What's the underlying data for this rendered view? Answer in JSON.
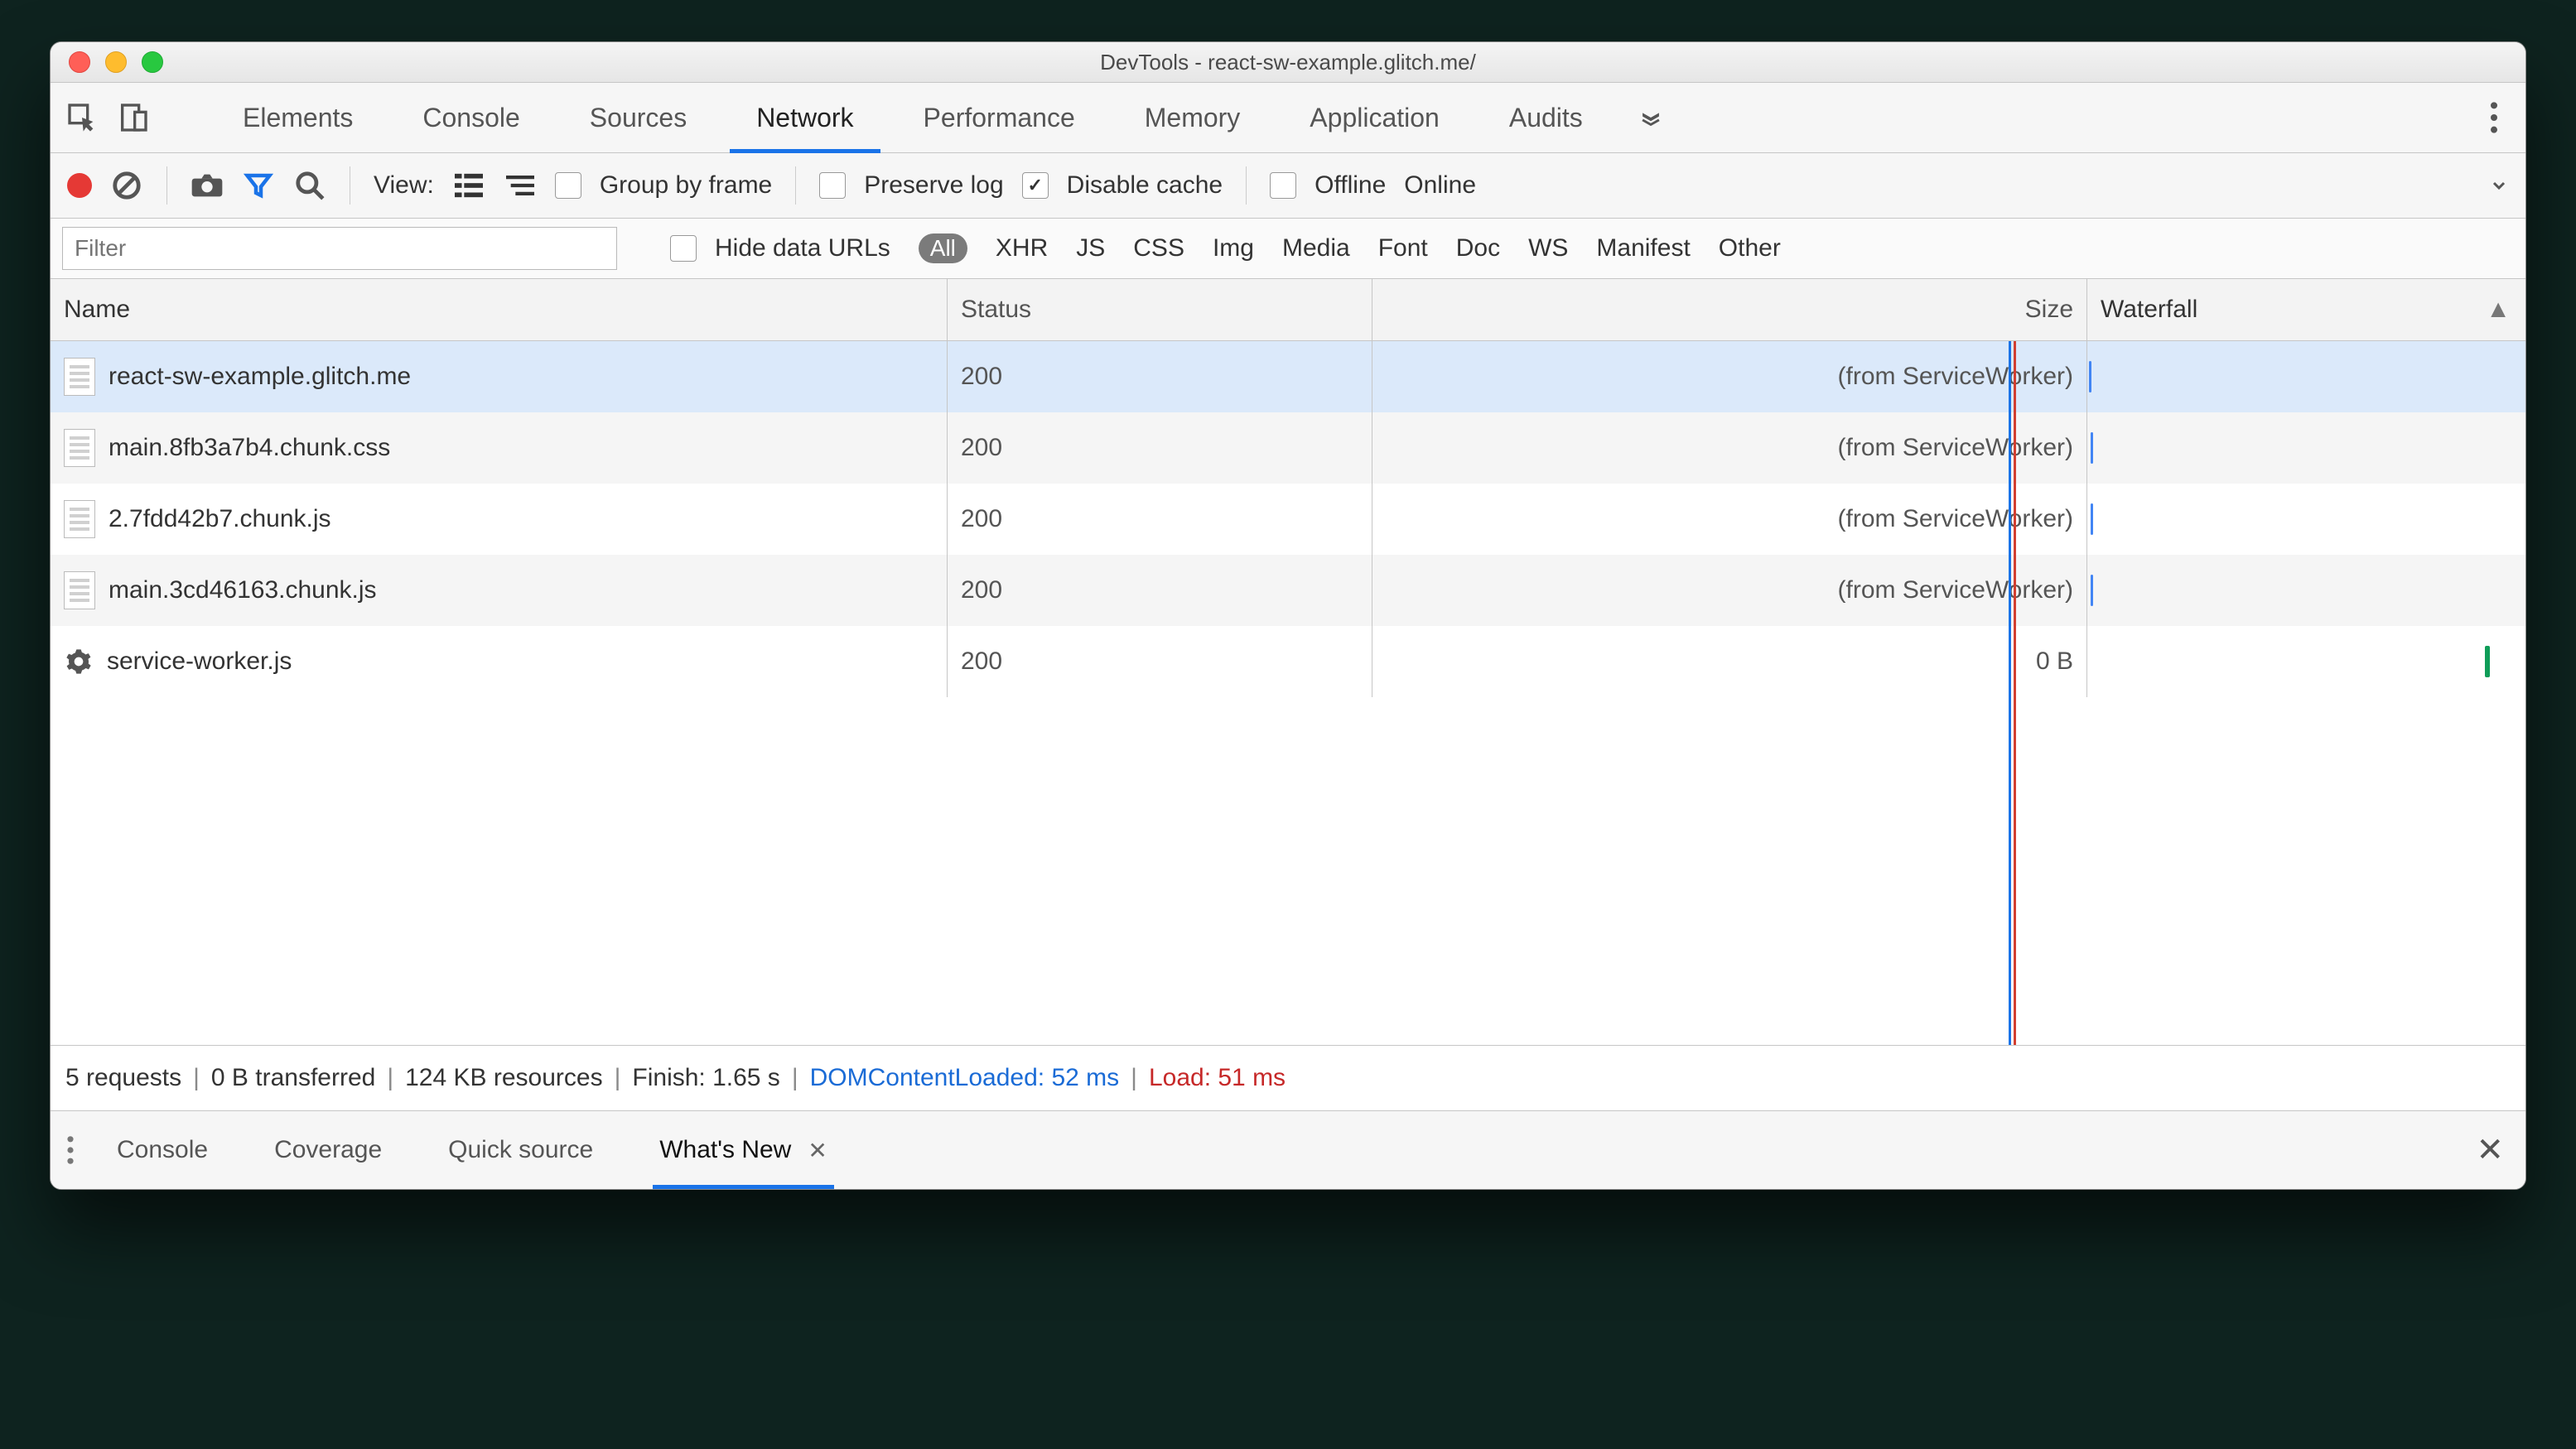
{
  "window": {
    "title": "DevTools - react-sw-example.glitch.me/"
  },
  "tabs": {
    "items": [
      "Elements",
      "Console",
      "Sources",
      "Network",
      "Performance",
      "Memory",
      "Application",
      "Audits"
    ],
    "activeIndex": 3
  },
  "toolbar": {
    "view_label": "View:",
    "group_by_frame": {
      "label": "Group by frame",
      "checked": false
    },
    "preserve_log": {
      "label": "Preserve log",
      "checked": false
    },
    "disable_cache": {
      "label": "Disable cache",
      "checked": true
    },
    "offline": {
      "label": "Offline",
      "checked": false
    },
    "online_label": "Online"
  },
  "filters": {
    "placeholder": "Filter",
    "hide_data_urls": {
      "label": "Hide data URLs",
      "checked": false
    },
    "types": [
      "All",
      "XHR",
      "JS",
      "CSS",
      "Img",
      "Media",
      "Font",
      "Doc",
      "WS",
      "Manifest",
      "Other"
    ],
    "activeType": "All"
  },
  "columns": {
    "name": "Name",
    "status": "Status",
    "size": "Size",
    "waterfall": "Waterfall"
  },
  "requests": [
    {
      "name": "react-sw-example.glitch.me",
      "status": "200",
      "size": "(from ServiceWorker)",
      "icon": "doc",
      "wf": {
        "start": 2,
        "len": 3,
        "color": "blue"
      },
      "selected": true
    },
    {
      "name": "main.8fb3a7b4.chunk.css",
      "status": "200",
      "size": "(from ServiceWorker)",
      "icon": "doc",
      "wf": {
        "start": 4,
        "len": 3,
        "color": "blue"
      }
    },
    {
      "name": "2.7fdd42b7.chunk.js",
      "status": "200",
      "size": "(from ServiceWorker)",
      "icon": "doc",
      "wf": {
        "start": 4,
        "len": 3,
        "color": "blue"
      }
    },
    {
      "name": "main.3cd46163.chunk.js",
      "status": "200",
      "size": "(from ServiceWorker)",
      "icon": "doc",
      "wf": {
        "start": 4,
        "len": 3,
        "color": "blue"
      }
    },
    {
      "name": "service-worker.js",
      "status": "200",
      "size": "0 B",
      "icon": "gear",
      "wf": {
        "start": 480,
        "len": 6,
        "color": "green"
      }
    }
  ],
  "waterfall": {
    "blueLine": 4,
    "redLine": 10
  },
  "summary": {
    "requests": "5 requests",
    "transferred": "0 B transferred",
    "resources": "124 KB resources",
    "finish": "Finish: 1.65 s",
    "dcl": "DOMContentLoaded: 52 ms",
    "load": "Load: 51 ms"
  },
  "drawer": {
    "tabs": [
      "Console",
      "Coverage",
      "Quick source",
      "What's New"
    ],
    "activeIndex": 3
  }
}
